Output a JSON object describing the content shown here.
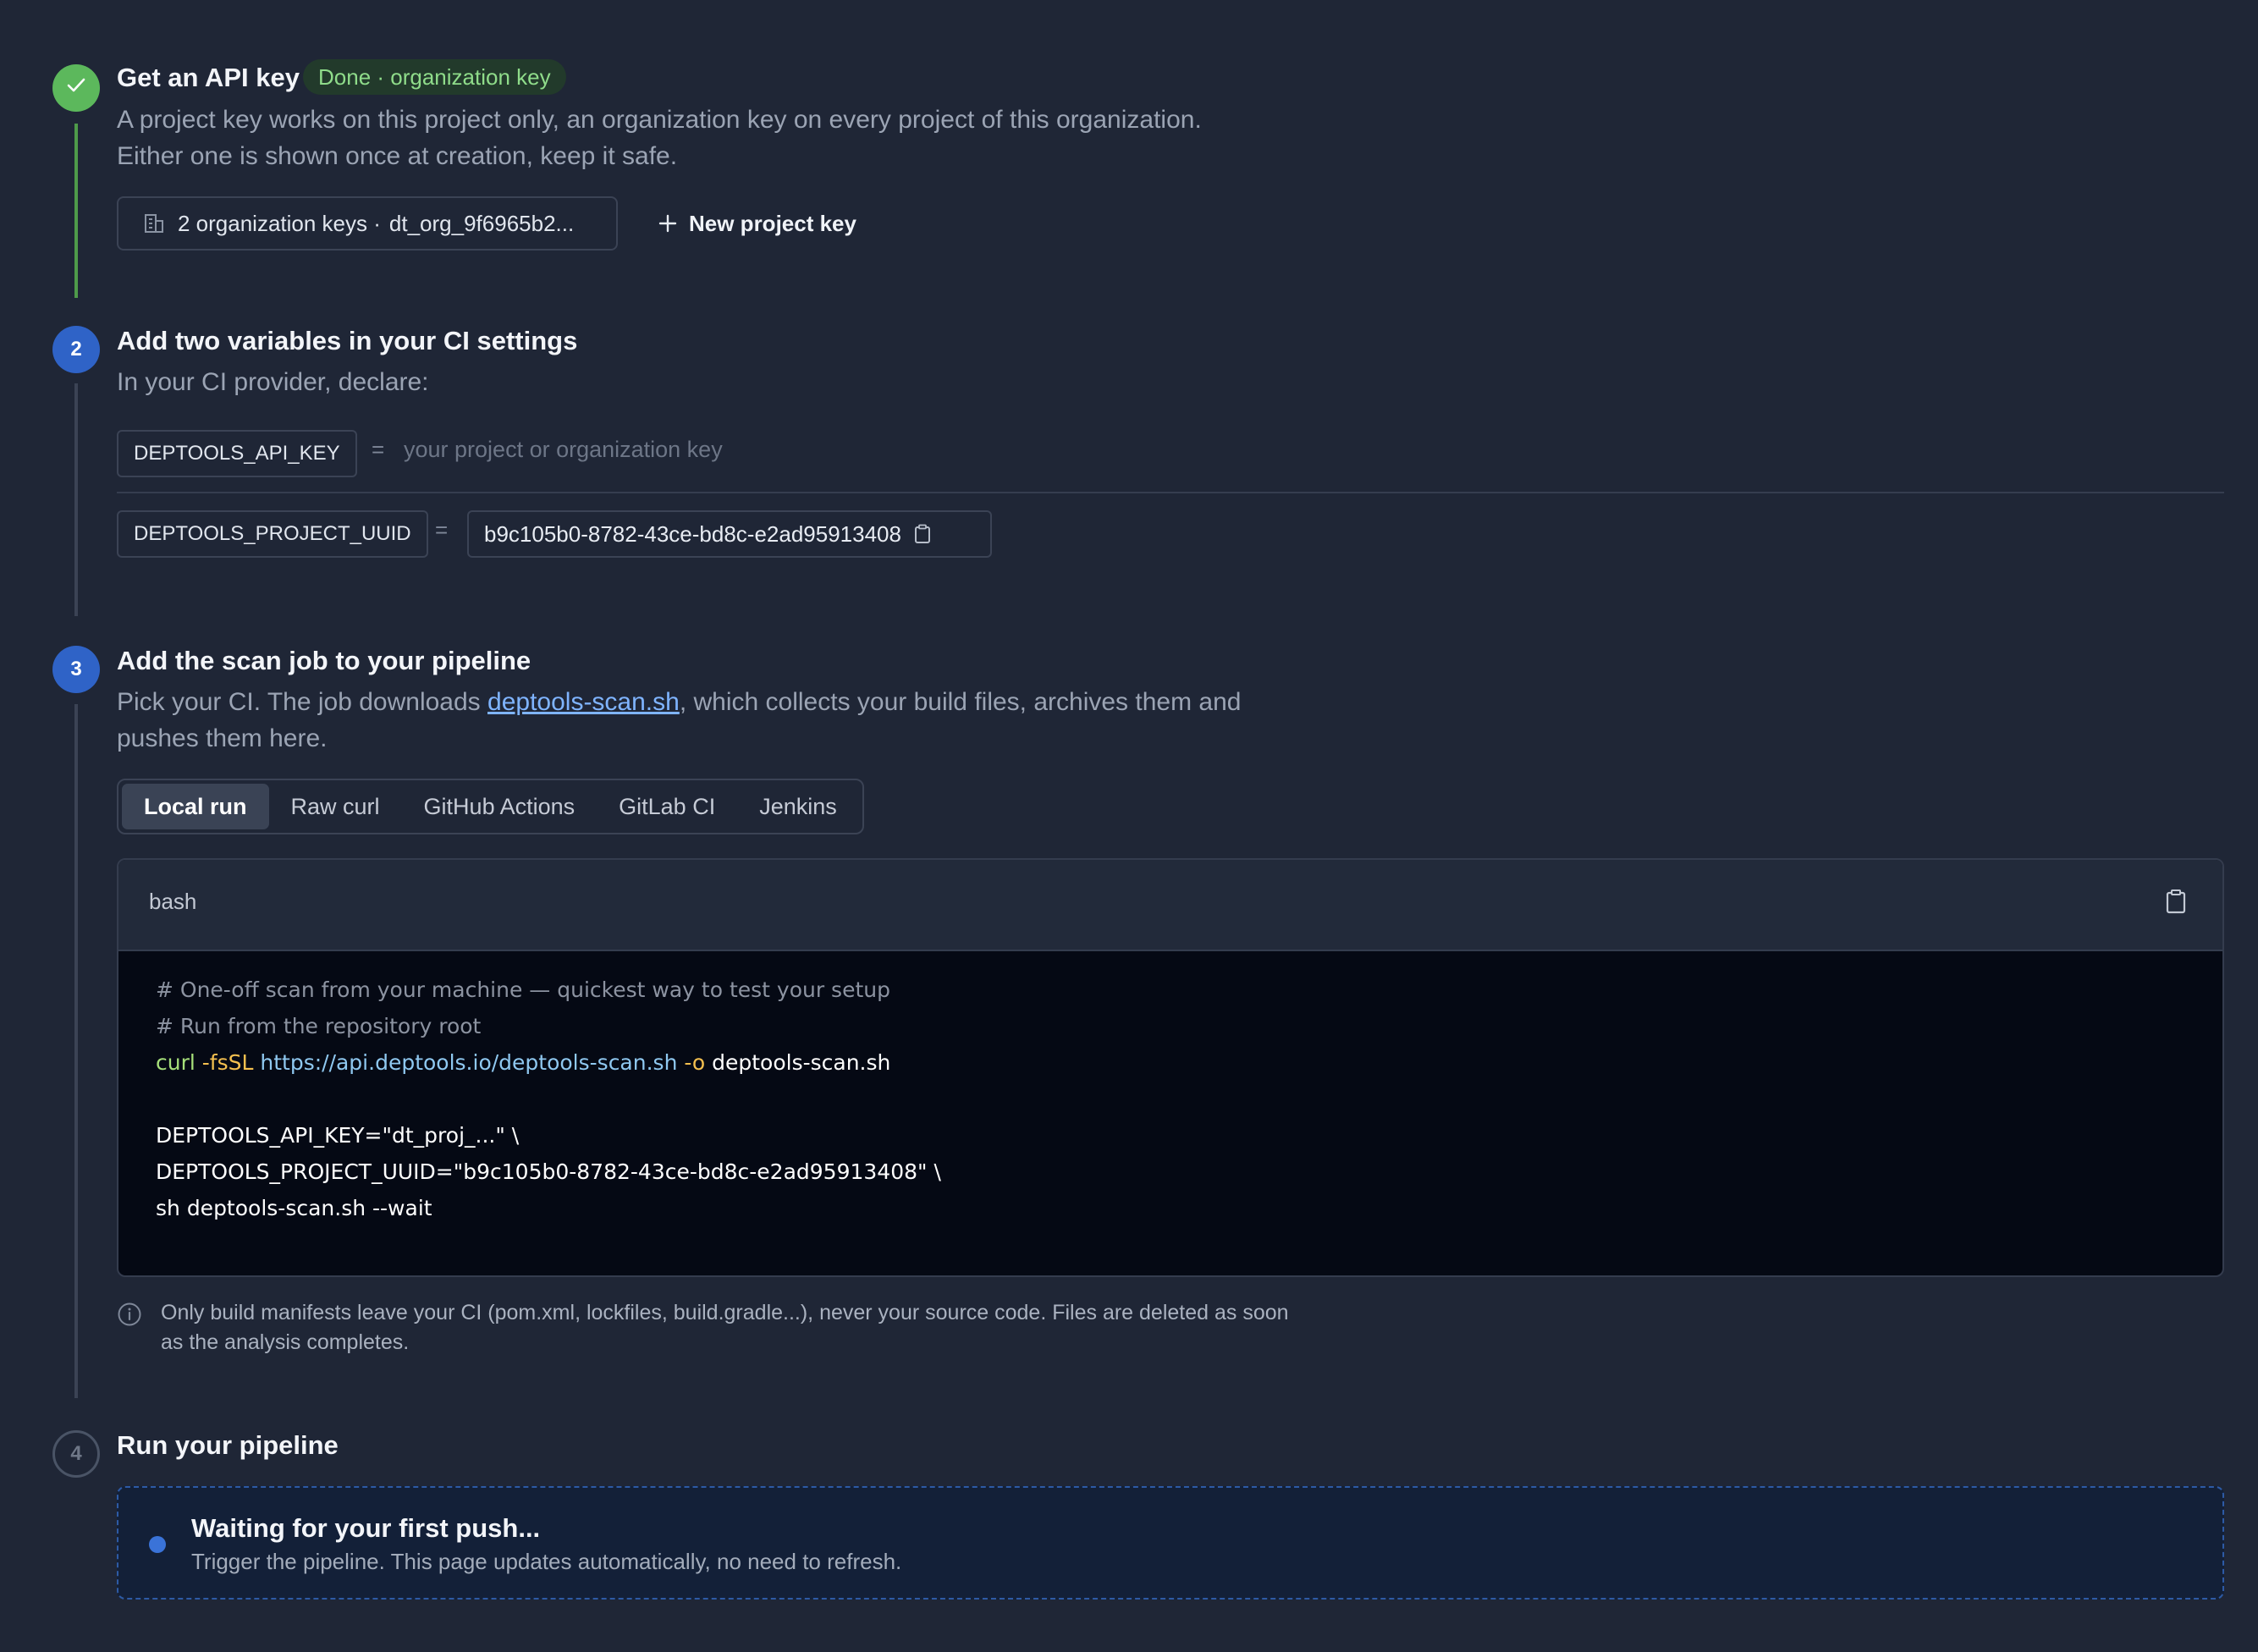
{
  "steps": [
    {
      "number": "1",
      "title": "Get an API key",
      "status_badge": "Done · organization key",
      "description": [
        "A project key works on this project only, an organization key on every project of this organization.",
        "Either one is shown once at creation, keep it safe."
      ],
      "org_keys_label": "2 organization keys ·",
      "org_key_preview": "dt_org_9f6965b2...",
      "new_project_key_label": "New project key"
    },
    {
      "number": "2",
      "title": "Add two variables in your CI settings",
      "description": "In your CI provider, declare:",
      "variables": [
        {
          "name": "DEPTOOLS_API_KEY",
          "equals": "=",
          "value_placeholder": "your project or organization key"
        },
        {
          "name": "DEPTOOLS_PROJECT_UUID",
          "equals": "=",
          "value": "b9c105b0-8782-43ce-bd8c-e2ad95913408"
        }
      ]
    },
    {
      "number": "3",
      "title": "Add the scan job to your pipeline",
      "description_before_link": "Pick your CI. The job downloads ",
      "description_link": "deptools-scan.sh",
      "description_after_link": ", which collects your build files, archives them and",
      "description_line2": "pushes them here.",
      "tabs": [
        "Local run",
        "Raw curl",
        "GitHub Actions",
        "GitLab CI",
        "Jenkins"
      ],
      "active_tab": "Local run",
      "code": {
        "language": "bash",
        "comment1": "# One-off scan from your machine — quickest way to test your setup",
        "comment2": "# Run from the repository root",
        "curl_cmd": "curl",
        "curl_flags": " -fsSL ",
        "curl_url": "https://api.deptools.io/deptools-scan.sh",
        "curl_out_flag": " -o ",
        "curl_out_file": "deptools-scan.sh",
        "env_key": "DEPTOOLS_API_KEY=\"dt_proj_...\" \\",
        "env_uuid": "DEPTOOLS_PROJECT_UUID=\"b9c105b0-8782-43ce-bd8c-e2ad95913408\" \\",
        "run": "sh deptools-scan.sh --wait"
      },
      "note_line1": "Only build manifests leave your CI (pom.xml, lockfiles, build.gradle...), never your source code. Files are deleted as soon",
      "note_line2": "as the analysis completes."
    },
    {
      "number": "4",
      "title": "Run your pipeline",
      "waiting_title": "Waiting for your first push...",
      "waiting_subtitle": "Trigger the pipeline. This page updates automatically, no need to refresh."
    }
  ],
  "colors": {
    "background": "#1f2636",
    "done": "#5cb85c",
    "active": "#2f63c7",
    "link": "#7fb4ff",
    "code_bg": "#050914"
  },
  "icons": [
    "check-icon",
    "building-icon",
    "plus-icon",
    "clipboard-icon",
    "info-icon"
  ]
}
